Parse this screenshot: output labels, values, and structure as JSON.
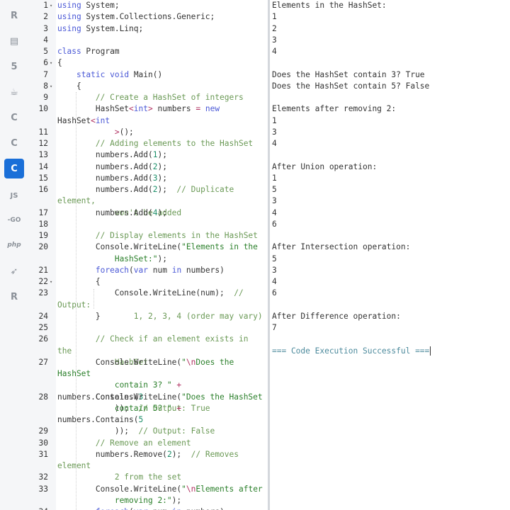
{
  "sidebar": {
    "items": [
      {
        "icon": "r-language-icon",
        "glyph": "R"
      },
      {
        "icon": "database-icon",
        "glyph": "▤"
      },
      {
        "icon": "html5-icon",
        "glyph": "5"
      },
      {
        "icon": "java-icon",
        "glyph": "☕"
      },
      {
        "icon": "c-language-icon",
        "glyph": "C"
      },
      {
        "icon": "cpp-icon",
        "glyph": "C"
      },
      {
        "icon": "csharp-icon",
        "glyph": "C",
        "active": true
      },
      {
        "icon": "javascript-icon",
        "glyph": "JS"
      },
      {
        "icon": "go-icon",
        "glyph": "-GO"
      },
      {
        "icon": "php-icon",
        "glyph": "php"
      },
      {
        "icon": "swift-icon",
        "glyph": "➶"
      },
      {
        "icon": "rust-icon",
        "glyph": "R"
      }
    ]
  },
  "editor": {
    "lines": [
      {
        "n": "1",
        "fold": true,
        "html": "<span class=\"kw\">using</span> System;"
      },
      {
        "n": "2",
        "html": "<span class=\"kw\">using</span> System.Collections.Generic;"
      },
      {
        "n": "3",
        "html": "<span class=\"kw\">using</span> System.Linq;"
      },
      {
        "n": "4",
        "html": ""
      },
      {
        "n": "5",
        "html": "<span class=\"kw\">class</span> Program"
      },
      {
        "n": "6",
        "fold": true,
        "html": "{"
      },
      {
        "n": "7",
        "html": "    <span class=\"kw\">static</span> <span class=\"kw\">void</span> Main()"
      },
      {
        "n": "8",
        "fold": true,
        "html": "    {"
      },
      {
        "n": "9",
        "html": "        <span class=\"cm\">// Create a HashSet of integers</span>"
      },
      {
        "n": "10",
        "rows": 2,
        "html": "        HashSet<span class=\"op\">&lt;</span><span class=\"ty\">int</span><span class=\"op\">&gt;</span> numbers <span class=\"op\">=</span> <span class=\"kw\">new</span> HashSet<span class=\"op\">&lt;</span><span class=\"ty\">int</span>\n            <span class=\"op\">&gt;</span>();"
      },
      {
        "n": "11",
        "html": ""
      },
      {
        "n": "12",
        "html": "        <span class=\"cm\">// Adding elements to the HashSet</span>"
      },
      {
        "n": "13",
        "html": "        numbers.Add(<span class=\"nm\">1</span>);"
      },
      {
        "n": "14",
        "html": "        numbers.Add(<span class=\"nm\">2</span>);"
      },
      {
        "n": "15",
        "html": "        numbers.Add(<span class=\"nm\">3</span>);"
      },
      {
        "n": "16",
        "rows": 2,
        "html": "        numbers.Add(<span class=\"nm\">2</span>);  <span class=\"cm\">// Duplicate element,\n            won't be added</span>"
      },
      {
        "n": "17",
        "html": "        numbers.Add(<span class=\"nm\">4</span>);"
      },
      {
        "n": "18",
        "html": ""
      },
      {
        "n": "19",
        "html": "        <span class=\"cm\">// Display elements in the HashSet</span>"
      },
      {
        "n": "20",
        "rows": 2,
        "html": "        Console.WriteLine(<span class=\"st\">\"Elements in the\n            HashSet:\"</span>);"
      },
      {
        "n": "21",
        "html": "        <span class=\"kw\">foreach</span>(<span class=\"kw\">var</span> num <span class=\"kw\">in</span> numbers)"
      },
      {
        "n": "22",
        "fold": true,
        "html": "        {"
      },
      {
        "n": "23",
        "rows": 2,
        "html": "            Console.WriteLine(num);  <span class=\"cm\">// Output:\n                1, 2, 3, 4 (order may vary)</span>"
      },
      {
        "n": "24",
        "html": "        }"
      },
      {
        "n": "25",
        "html": ""
      },
      {
        "n": "26",
        "rows": 2,
        "html": "        <span class=\"cm\">// Check if an element exists in the\n            HashSet</span>"
      },
      {
        "n": "27",
        "rows": 3,
        "html": "        Console.WriteLine(<span class=\"st\">\"</span><span class=\"op\">\\n</span><span class=\"st\">Does the HashSet\n            contain 3? \"</span> <span class=\"op\">+</span> numbers.Contains(<span class=\"nm\">3</span>\n            ));  <span class=\"cm\">// Output: True</span>"
      },
      {
        "n": "28",
        "rows": 3,
        "html": "        Console.WriteLine(<span class=\"st\">\"Does the HashSet\n            contain 5? \"</span> <span class=\"op\">+</span> numbers.Contains(<span class=\"nm\">5</span>\n            ));  <span class=\"cm\">// Output: False</span>"
      },
      {
        "n": "29",
        "html": ""
      },
      {
        "n": "30",
        "html": "        <span class=\"cm\">// Remove an element</span>"
      },
      {
        "n": "31",
        "rows": 2,
        "html": "        numbers.Remove(<span class=\"nm\">2</span>);  <span class=\"cm\">// Removes element\n            2 from the set</span>"
      },
      {
        "n": "32",
        "html": ""
      },
      {
        "n": "33",
        "rows": 2,
        "html": "        Console.WriteLine(<span class=\"st\">\"</span><span class=\"op\">\\n</span><span class=\"st\">Elements after\n            removing 2:\"</span>);"
      },
      {
        "n": "34",
        "html": "        <span class=\"kw\">foreach</span>(<span class=\"kw\">var</span> num <span class=\"kw\">in</span> numbers)"
      }
    ]
  },
  "output": {
    "lines": [
      "Elements in the HashSet:",
      "1",
      "2",
      "3",
      "4",
      "",
      "Does the HashSet contain 3? True",
      "Does the HashSet contain 5? False",
      "",
      "Elements after removing 2:",
      "1",
      "3",
      "4",
      "",
      "After Union operation:",
      "1",
      "5",
      "3",
      "4",
      "6",
      "",
      "After Intersection operation:",
      "5",
      "3",
      "4",
      "6",
      "",
      "After Difference operation:",
      "7",
      "",
      "=== Code Execution Successful ==="
    ],
    "success_line_index": 30
  },
  "colors": {
    "accent": "#1a6fd8",
    "keyword": "#4a58d6",
    "comment": "#6a9955",
    "string": "#2a7f2a",
    "success": "#4c8a9c"
  }
}
